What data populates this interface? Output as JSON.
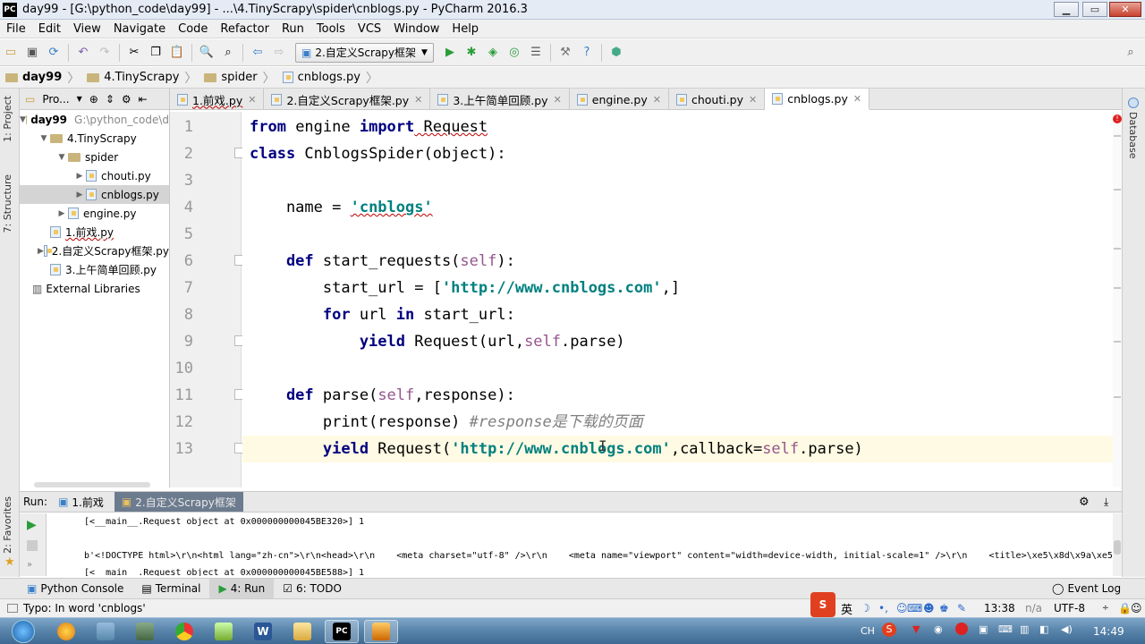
{
  "window": {
    "title": "day99 - [G:\\python_code\\day99] - ...\\4.TinyScrapy\\spider\\cnblogs.py - PyCharm 2016.3",
    "app_icon": "PC"
  },
  "menu": [
    "File",
    "Edit",
    "View",
    "Navigate",
    "Code",
    "Refactor",
    "Run",
    "Tools",
    "VCS",
    "Window",
    "Help"
  ],
  "toolbar": {
    "run_config": "2.自定义Scrapy框架"
  },
  "breadcrumb": [
    "day99",
    "4.TinyScrapy",
    "spider",
    "cnblogs.py"
  ],
  "left_strip": {
    "project": "1: Project",
    "structure": "7: Structure",
    "favorites": "2: Favorites"
  },
  "right_strip": {
    "database": "Database"
  },
  "project": {
    "header": "Pro...",
    "tree": [
      {
        "label": "day99",
        "extra": "G:\\python_code\\d",
        "indent": 0,
        "arrow": "▼",
        "icon": "folder",
        "bold": true
      },
      {
        "label": "4.TinyScrapy",
        "indent": 1,
        "arrow": "▼",
        "icon": "folder"
      },
      {
        "label": "spider",
        "indent": 2,
        "arrow": "▼",
        "icon": "folder"
      },
      {
        "label": "chouti.py",
        "indent": 3,
        "arrow": "▶",
        "icon": "py"
      },
      {
        "label": "cnblogs.py",
        "indent": 3,
        "arrow": "▶",
        "icon": "py",
        "selected": true
      },
      {
        "label": "engine.py",
        "indent": 2,
        "arrow": "▶",
        "icon": "py"
      },
      {
        "label": "1.前戏.py",
        "indent": 1,
        "arrow": "",
        "icon": "py",
        "squiggle": true
      },
      {
        "label": "2.自定义Scrapy框架.py",
        "indent": 1,
        "arrow": "▶",
        "icon": "py"
      },
      {
        "label": "3.上午简单回顾.py",
        "indent": 1,
        "arrow": "",
        "icon": "py"
      },
      {
        "label": "External Libraries",
        "indent": 0,
        "arrow": "",
        "icon": "lib"
      }
    ]
  },
  "tabs": [
    {
      "label": "1.前戏.py",
      "squiggle": true
    },
    {
      "label": "2.自定义Scrapy框架.py"
    },
    {
      "label": "3.上午简单回顾.py"
    },
    {
      "label": "engine.py"
    },
    {
      "label": "chouti.py"
    },
    {
      "label": "cnblogs.py",
      "active": true
    }
  ],
  "code": {
    "line_numbers": [
      "1",
      "2",
      "3",
      "4",
      "5",
      "6",
      "7",
      "8",
      "9",
      "10",
      "11",
      "12",
      "13"
    ],
    "l1": {
      "kw1": "from",
      "t1": " engine ",
      "kw2": "import",
      "t2": " Request"
    },
    "l2": {
      "kw": "class",
      "t": " CnblogsSpider(object):"
    },
    "l4": {
      "t": "    name = ",
      "s": "'cnblogs'"
    },
    "l6": {
      "kw": "    def",
      "t1": " start_requests(",
      "self": "self",
      "t2": "):"
    },
    "l7": {
      "t1": "        start_url = [",
      "s": "'http://www.cnblogs.com'",
      "t2": ",]"
    },
    "l8": {
      "kw1": "        for",
      "t1": " url ",
      "kw2": "in",
      "t2": " start_url:"
    },
    "l9": {
      "kw": "            yield",
      "t1": " Request(url,",
      "self": "self",
      "t2": ".parse)"
    },
    "l11": {
      "kw": "    def",
      "t1": " parse(",
      "self": "self",
      "t2": ",response):"
    },
    "l12": {
      "t1": "        print(response) ",
      "cm": "#response是下载的页面"
    },
    "l13": {
      "kw": "        yield",
      "t1": " Request(",
      "s": "'http://www.cnblogs.com'",
      "t2": ",callback=",
      "self": "self",
      "t3": ".parse)"
    }
  },
  "run": {
    "label": "Run:",
    "tabs": [
      "1.前戏",
      "2.自定义Scrapy框架"
    ],
    "output": [
      "[<__main__.Request object at 0x000000000045BE320>] 1",
      "",
      "b'<!DOCTYPE html>\\r\\n<html lang=\"zh-cn\">\\r\\n<head>\\r\\n    <meta charset=\"utf-8\" />\\r\\n    <meta name=\"viewport\" content=\"width=device-width, initial-scale=1\" />\\r\\n    <title>\\xe5\\x8d\\x9a\\xe5\\xa",
      "[<__main__.Request object at 0x000000000045BE588>] 1"
    ]
  },
  "bottom_tabs": [
    {
      "label": "Python Console"
    },
    {
      "label": "Terminal"
    },
    {
      "label": "4: Run",
      "active": true
    },
    {
      "label": "6: TODO"
    }
  ],
  "event_log": "Event Log",
  "status": {
    "message": "Typo: In word 'cnblogs'",
    "position": "13:38",
    "na": "n/a",
    "encoding": "UTF-8",
    "ime": "英"
  },
  "taskbar": {
    "lang": "CH",
    "time": "14:49"
  },
  "colors": {
    "keyword": "#000080",
    "string": "#008080",
    "self": "#94558d",
    "comment": "#808080",
    "current_line": "#fffae3"
  }
}
